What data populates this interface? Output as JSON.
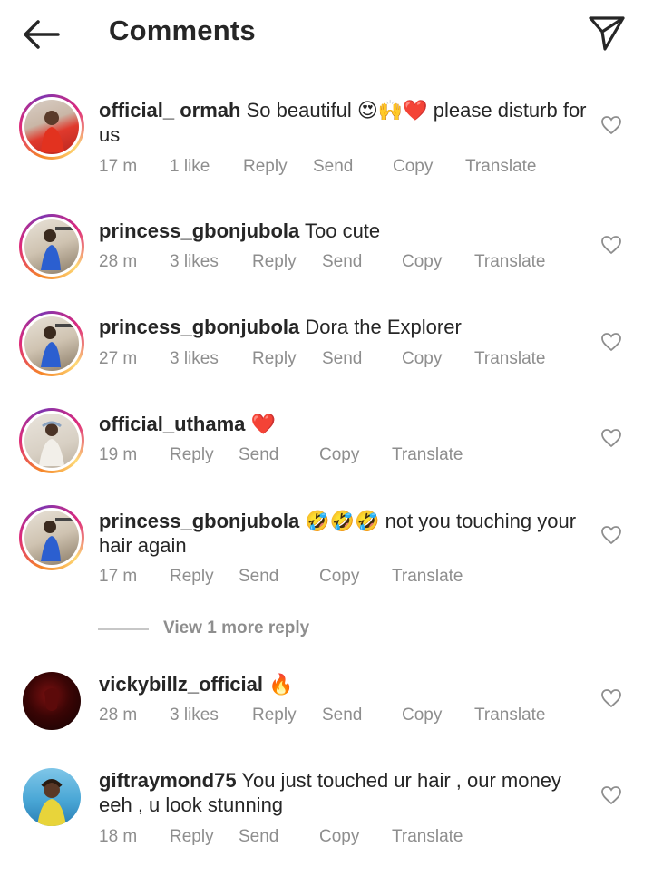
{
  "header": {
    "title": "Comments",
    "back_icon": "arrow-left-icon",
    "share_icon": "paper-plane-icon"
  },
  "comments": [
    {
      "username": "official_ ormah",
      "text": "So beautiful 😍🙌❤️ please disturb for us",
      "time": "17 m",
      "likes": "1 like",
      "reply": "Reply",
      "send": "Send",
      "copy": "Copy",
      "translate": "Translate"
    },
    {
      "username": "princess_gbonjubola",
      "text": "Too cute",
      "time": "28 m",
      "likes": "3 likes",
      "reply": "Reply",
      "send": "Send",
      "copy": "Copy",
      "translate": "Translate"
    },
    {
      "username": "princess_gbonjubola",
      "text": "Dora the Explorer",
      "time": "27 m",
      "likes": "3 likes",
      "reply": "Reply",
      "send": "Send",
      "copy": "Copy",
      "translate": "Translate"
    },
    {
      "username": "official_uthama",
      "text": "❤️",
      "time": "19 m",
      "reply": "Reply",
      "send": "Send",
      "copy": "Copy",
      "translate": "Translate"
    },
    {
      "username": "princess_gbonjubola",
      "text": "🤣🤣🤣 not you touching your hair again",
      "time": "17 m",
      "reply": "Reply",
      "send": "Send",
      "copy": "Copy",
      "translate": "Translate"
    },
    {
      "username": "vickybillz_official",
      "text": "🔥",
      "time": "28 m",
      "likes": "3 likes",
      "reply": "Reply",
      "send": "Send",
      "copy": "Copy",
      "translate": "Translate"
    },
    {
      "username": "giftraymond75",
      "text": "You just touched ur hair , our money eeh , u look stunning",
      "time": "18 m",
      "reply": "Reply",
      "send": "Send",
      "copy": "Copy",
      "translate": "Translate"
    }
  ],
  "view_more_replies": "View 1 more reply",
  "icons": {
    "like": "heart-outline-icon"
  },
  "colors": {
    "text": "#262626",
    "secondary": "#8e8e8e",
    "story_ring_start": "#f58529",
    "story_ring_end": "#dd2a7b"
  }
}
